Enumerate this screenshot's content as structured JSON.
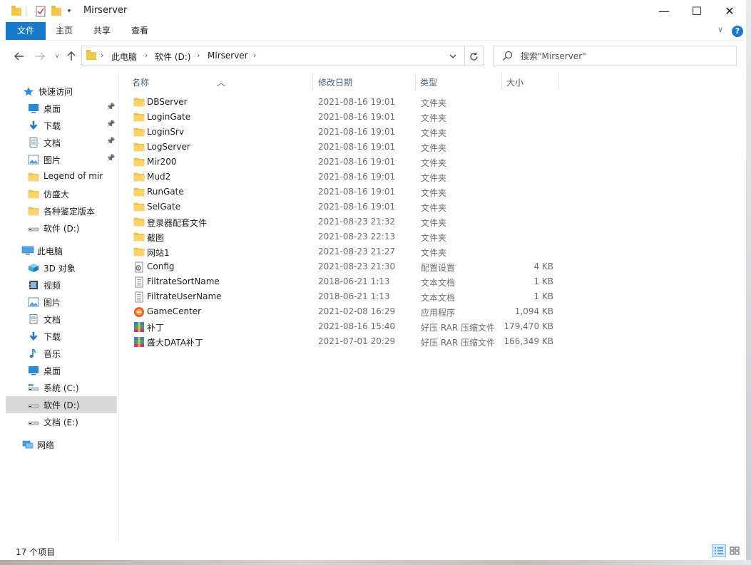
{
  "window": {
    "title": "Mirserver",
    "minimize_glyph": "—",
    "maximize_glyph": "☐",
    "close_glyph": "✕"
  },
  "ribbon": {
    "tabs": [
      "文件",
      "主页",
      "共享",
      "查看"
    ],
    "help_glyph": "?",
    "collapse_glyph": "∨"
  },
  "nav": {
    "breadcrumb": [
      "此电脑",
      "软件 (D:)",
      "Mirserver"
    ],
    "search_placeholder": "搜索\"Mirserver\""
  },
  "sidebar": {
    "quick_access_label": "快速访问",
    "quick_items": [
      {
        "label": "桌面",
        "icon": "desktop-icon",
        "pinned": true
      },
      {
        "label": "下载",
        "icon": "download-icon",
        "pinned": true
      },
      {
        "label": "文档",
        "icon": "document-icon",
        "pinned": true
      },
      {
        "label": "图片",
        "icon": "picture-icon",
        "pinned": true
      },
      {
        "label": "Legend of mir",
        "icon": "folder-icon",
        "pinned": false
      },
      {
        "label": "仿盛大",
        "icon": "folder-icon",
        "pinned": false
      },
      {
        "label": "各种鉴定版本",
        "icon": "folder-icon",
        "pinned": false
      },
      {
        "label": "软件 (D:)",
        "icon": "drive-icon",
        "pinned": false
      }
    ],
    "this_pc_label": "此电脑",
    "pc_items": [
      {
        "label": "3D 对象",
        "icon": "3d-objects-icon"
      },
      {
        "label": "视频",
        "icon": "video-icon"
      },
      {
        "label": "图片",
        "icon": "picture-icon"
      },
      {
        "label": "文档",
        "icon": "document-icon"
      },
      {
        "label": "下载",
        "icon": "download-icon"
      },
      {
        "label": "音乐",
        "icon": "music-icon"
      },
      {
        "label": "桌面",
        "icon": "desktop-icon"
      },
      {
        "label": "系统 (C:)",
        "icon": "system-drive-icon"
      },
      {
        "label": "软件 (D:)",
        "icon": "drive-icon",
        "selected": true
      },
      {
        "label": "文档 (E:)",
        "icon": "drive-icon"
      }
    ],
    "network_label": "网络"
  },
  "columns": {
    "name": "名称",
    "date": "修改日期",
    "type": "类型",
    "size": "大小"
  },
  "files": [
    {
      "name": "DBServer",
      "date": "2021-08-16 19:01",
      "type": "文件夹",
      "size": "",
      "icon": "folder-icon"
    },
    {
      "name": "LoginGate",
      "date": "2021-08-16 19:01",
      "type": "文件夹",
      "size": "",
      "icon": "folder-icon"
    },
    {
      "name": "LoginSrv",
      "date": "2021-08-16 19:01",
      "type": "文件夹",
      "size": "",
      "icon": "folder-icon"
    },
    {
      "name": "LogServer",
      "date": "2021-08-16 19:01",
      "type": "文件夹",
      "size": "",
      "icon": "folder-icon"
    },
    {
      "name": "Mir200",
      "date": "2021-08-16 19:01",
      "type": "文件夹",
      "size": "",
      "icon": "folder-icon"
    },
    {
      "name": "Mud2",
      "date": "2021-08-16 19:01",
      "type": "文件夹",
      "size": "",
      "icon": "folder-icon"
    },
    {
      "name": "RunGate",
      "date": "2021-08-16 19:01",
      "type": "文件夹",
      "size": "",
      "icon": "folder-icon"
    },
    {
      "name": "SelGate",
      "date": "2021-08-16 19:01",
      "type": "文件夹",
      "size": "",
      "icon": "folder-icon"
    },
    {
      "name": "登录器配套文件",
      "date": "2021-08-23 21:32",
      "type": "文件夹",
      "size": "",
      "icon": "folder-icon"
    },
    {
      "name": "截图",
      "date": "2021-08-23 22:13",
      "type": "文件夹",
      "size": "",
      "icon": "folder-icon"
    },
    {
      "name": "网站1",
      "date": "2021-08-23 21:27",
      "type": "文件夹",
      "size": "",
      "icon": "folder-icon"
    },
    {
      "name": "Config",
      "date": "2021-08-23 21:30",
      "type": "配置设置",
      "size": "4 KB",
      "icon": "config-file-icon"
    },
    {
      "name": "FiltrateSortName",
      "date": "2018-06-21 1:13",
      "type": "文本文档",
      "size": "1 KB",
      "icon": "text-file-icon"
    },
    {
      "name": "FiltrateUserName",
      "date": "2018-06-21 1:13",
      "type": "文本文档",
      "size": "1 KB",
      "icon": "text-file-icon"
    },
    {
      "name": "GameCenter",
      "date": "2021-02-08 16:29",
      "type": "应用程序",
      "size": "1,094 KB",
      "icon": "application-icon"
    },
    {
      "name": "补丁",
      "date": "2021-08-16 15:40",
      "type": "好压 RAR 压缩文件",
      "size": "179,470 KB",
      "icon": "rar-archive-icon"
    },
    {
      "name": "盛大DATA补丁",
      "date": "2021-07-01 20:29",
      "type": "好压 RAR 压缩文件",
      "size": "166,349 KB",
      "icon": "rar-archive-icon"
    }
  ],
  "status": {
    "count": "17 个项目"
  },
  "colors": {
    "accent": "#1979ca",
    "folder": "#f3c84a",
    "selected_bg": "#d9d9d9",
    "header_text": "#4c607a"
  }
}
